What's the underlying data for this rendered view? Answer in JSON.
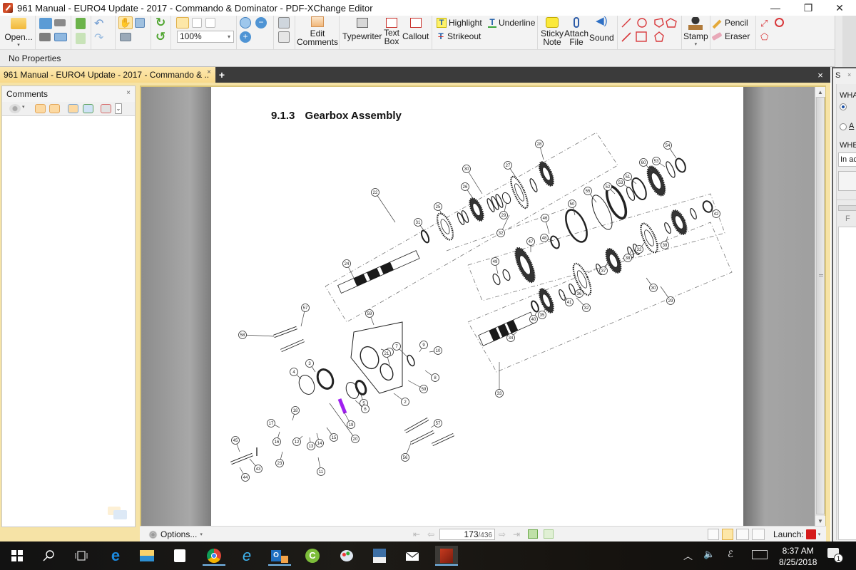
{
  "window": {
    "title": "961 Manual - EURO4 Update - 2017 - Commando & Dominator - PDF-XChange Editor",
    "controls": {
      "minimize": "—",
      "restore": "❐",
      "close": "✕"
    }
  },
  "toolbar": {
    "open": "Open...",
    "zoom_value": "100%",
    "edit_comments": [
      "Edit",
      "Comments"
    ],
    "typewriter": "Typewriter",
    "text_box": [
      "Text",
      "Box"
    ],
    "callout": "Callout",
    "highlight": "Highlight",
    "underline": "Underline",
    "strikeout": "Strikeout",
    "sticky_note": [
      "Sticky",
      "Note"
    ],
    "attach_file": [
      "Attach",
      "File"
    ],
    "sound": "Sound",
    "stamp": "Stamp",
    "pencil": "Pencil",
    "eraser": "Eraser",
    "properties": "No Properties"
  },
  "tabs": {
    "active_tab": "961 Manual - EURO4 Update - 2017 - Commando & ..",
    "close": "×",
    "new_tab": "+",
    "close_all": "×"
  },
  "comments_panel": {
    "title": "Comments",
    "close": "×"
  },
  "document": {
    "section_number": "9.1.3",
    "section_title": "Gearbox Assembly",
    "diagram_labels": [
      "1",
      "2",
      "3",
      "4",
      "5",
      "6",
      "7",
      "8",
      "9",
      "10",
      "11",
      "12",
      "13",
      "14",
      "15",
      "16",
      "17",
      "18",
      "19",
      "20",
      "21",
      "22",
      "23",
      "24",
      "25",
      "26",
      "27",
      "28",
      "29",
      "30",
      "31",
      "32",
      "33",
      "34",
      "35",
      "36",
      "37",
      "38",
      "39",
      "40",
      "41",
      "42",
      "43",
      "44",
      "45",
      "46",
      "47",
      "48",
      "49",
      "50",
      "51",
      "52",
      "53",
      "54",
      "55",
      "56",
      "57",
      "58",
      "59"
    ]
  },
  "statusbar": {
    "options": "Options...",
    "current_page": "173",
    "total_pages": "/436",
    "launch": "Launch:"
  },
  "search_panel": {
    "title": "S",
    "close": "×",
    "what_label": "WHA",
    "option_a": "A",
    "where_label": "WHE",
    "where_value": "In ac",
    "footer": "F"
  },
  "taskbar": {
    "time": "8:37 AM",
    "date": "8/25/2018",
    "notifications": "1",
    "apps": [
      "start",
      "search",
      "task-view",
      "edge",
      "file-explorer",
      "store",
      "chrome",
      "internet-explorer",
      "outlook",
      "c-app",
      "paint",
      "app-person",
      "mail",
      "pdf-xchange"
    ]
  },
  "colors": {
    "tab_active": "#f8d98a",
    "frame_accent": "#d9c478",
    "highlight_marker": "#a020f0"
  }
}
